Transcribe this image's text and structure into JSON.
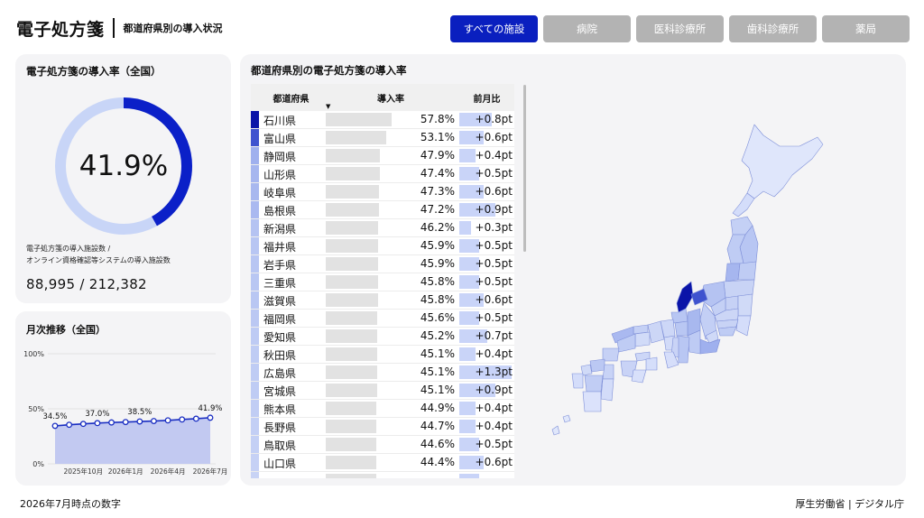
{
  "header": {
    "title": "電子処方箋",
    "subtitle": "都道府県別の導入状況",
    "filters": [
      {
        "label": "すべての施設",
        "active": true
      },
      {
        "label": "病院",
        "active": false
      },
      {
        "label": "医科診療所",
        "active": false
      },
      {
        "label": "歯科診療所",
        "active": false
      },
      {
        "label": "薬局",
        "active": false
      }
    ]
  },
  "rate_card": {
    "title": "電子処方箋の導入率（全国）",
    "rate_text": "41.9%",
    "rate_value": 0.419,
    "caption_line1": "電子処方箋の導入施設数 /",
    "caption_line2": "オンライン資格確認等システムの導入施設数",
    "count_text": "88,995 / 212,382",
    "colors": {
      "filled": "#0b20c8",
      "remaining": "#c8d5f7"
    }
  },
  "trend_card": {
    "title": "月次推移（全国）",
    "chart_data": {
      "type": "area",
      "y_ticks": [
        "100%",
        "50%",
        "0%"
      ],
      "x_tick_labels": [
        "2025年10月",
        "2026年1月",
        "2026年4月",
        "2026年7月"
      ],
      "ylim": [
        0,
        100
      ],
      "values": [
        34.5,
        35.5,
        36.3,
        37.0,
        37.6,
        38.0,
        38.5,
        38.9,
        39.5,
        40.3,
        41.0,
        41.9
      ],
      "data_labels": [
        {
          "index": 0,
          "text": "34.5%"
        },
        {
          "index": 3,
          "text": "37.0%"
        },
        {
          "index": 6,
          "text": "38.5%"
        },
        {
          "index": 11,
          "text": "41.9%"
        }
      ],
      "colors": {
        "line": "#1a2ec2",
        "fill": "#c2c9f1"
      }
    }
  },
  "map_card": {
    "title": "都道府県別の電子処方箋の導入率",
    "table": {
      "headers": {
        "pref": "都道府県",
        "rate": "導入率",
        "diff": "前月比"
      },
      "sort_icon": "▼",
      "rows": [
        {
          "pref": "石川県",
          "rate": "57.8%",
          "diff": "+0.8pt",
          "rate_v": 57.8,
          "diff_v": 0.8,
          "color": "#0a14a8"
        },
        {
          "pref": "富山県",
          "rate": "53.1%",
          "diff": "+0.6pt",
          "rate_v": 53.1,
          "diff_v": 0.6,
          "color": "#3f53cf"
        },
        {
          "pref": "静岡県",
          "rate": "47.9%",
          "diff": "+0.4pt",
          "rate_v": 47.9,
          "diff_v": 0.4,
          "color": "#9fb0ee"
        },
        {
          "pref": "山形県",
          "rate": "47.4%",
          "diff": "+0.5pt",
          "rate_v": 47.4,
          "diff_v": 0.5,
          "color": "#a6b6ef"
        },
        {
          "pref": "岐阜県",
          "rate": "47.3%",
          "diff": "+0.6pt",
          "rate_v": 47.3,
          "diff_v": 0.6,
          "color": "#a8b8ef"
        },
        {
          "pref": "島根県",
          "rate": "47.2%",
          "diff": "+0.9pt",
          "rate_v": 47.2,
          "diff_v": 0.9,
          "color": "#aab9f0"
        },
        {
          "pref": "新潟県",
          "rate": "46.2%",
          "diff": "+0.3pt",
          "rate_v": 46.2,
          "diff_v": 0.3,
          "color": "#b5c3f2"
        },
        {
          "pref": "福井県",
          "rate": "45.9%",
          "diff": "+0.5pt",
          "rate_v": 45.9,
          "diff_v": 0.5,
          "color": "#b8c6f3"
        },
        {
          "pref": "岩手県",
          "rate": "45.9%",
          "diff": "+0.5pt",
          "rate_v": 45.9,
          "diff_v": 0.5,
          "color": "#b8c6f3"
        },
        {
          "pref": "三重県",
          "rate": "45.8%",
          "diff": "+0.5pt",
          "rate_v": 45.8,
          "diff_v": 0.5,
          "color": "#b9c7f3"
        },
        {
          "pref": "滋賀県",
          "rate": "45.8%",
          "diff": "+0.6pt",
          "rate_v": 45.8,
          "diff_v": 0.6,
          "color": "#b9c7f3"
        },
        {
          "pref": "福岡県",
          "rate": "45.6%",
          "diff": "+0.5pt",
          "rate_v": 45.6,
          "diff_v": 0.5,
          "color": "#bbc8f3"
        },
        {
          "pref": "愛知県",
          "rate": "45.2%",
          "diff": "+0.7pt",
          "rate_v": 45.2,
          "diff_v": 0.7,
          "color": "#becbf4"
        },
        {
          "pref": "秋田県",
          "rate": "45.1%",
          "diff": "+0.4pt",
          "rate_v": 45.1,
          "diff_v": 0.4,
          "color": "#bfccf4"
        },
        {
          "pref": "広島県",
          "rate": "45.1%",
          "diff": "+1.3pt",
          "rate_v": 45.1,
          "diff_v": 1.3,
          "color": "#bfccf4"
        },
        {
          "pref": "宮城県",
          "rate": "45.1%",
          "diff": "+0.9pt",
          "rate_v": 45.1,
          "diff_v": 0.9,
          "color": "#bfccf4"
        },
        {
          "pref": "熊本県",
          "rate": "44.9%",
          "diff": "+0.4pt",
          "rate_v": 44.9,
          "diff_v": 0.4,
          "color": "#c1cdf4"
        },
        {
          "pref": "長野県",
          "rate": "44.7%",
          "diff": "+0.4pt",
          "rate_v": 44.7,
          "diff_v": 0.4,
          "color": "#c3cff5"
        },
        {
          "pref": "鳥取県",
          "rate": "44.6%",
          "diff": "+0.5pt",
          "rate_v": 44.6,
          "diff_v": 0.5,
          "color": "#c4d0f5"
        },
        {
          "pref": "山口県",
          "rate": "44.4%",
          "diff": "+0.6pt",
          "rate_v": 44.4,
          "diff_v": 0.6,
          "color": "#c6d1f5"
        },
        {
          "pref": "",
          "rate": "",
          "diff": "",
          "rate_v": 44.2,
          "diff_v": 0.5,
          "color": "#c8d3f5"
        }
      ]
    }
  },
  "footer": {
    "left": "2026年7月時点の数字",
    "right": "厚生労働省 | デジタル庁"
  }
}
